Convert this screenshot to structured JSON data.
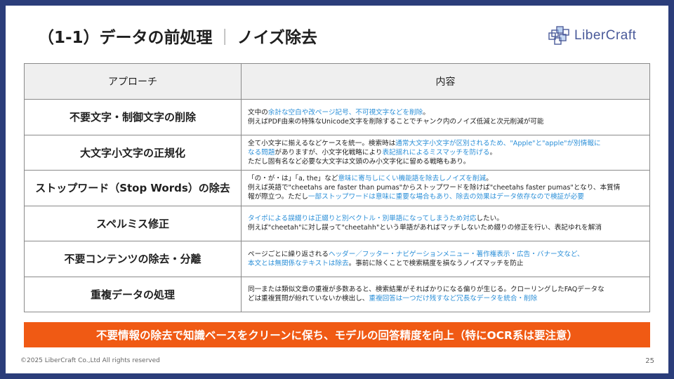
{
  "title": {
    "text": "（1-1）データの前処理",
    "separator": "｜",
    "subtitle": "ノイズ除去"
  },
  "logo": {
    "text": "LiberCraft",
    "icon": "cube-cluster-icon",
    "color": "#4a5a9a"
  },
  "table": {
    "headers": [
      "アプローチ",
      "内容"
    ],
    "rows": [
      {
        "approach": "不要文字・制御文字の削除",
        "lines": [
          [
            {
              "t": "文中の"
            },
            {
              "t": "余計な空白や改ページ記号、不可視文字などを削除",
              "h": true
            },
            {
              "t": "。"
            }
          ],
          [
            {
              "t": "例えばPDF由来の特殊なUnicode文字を削除することでチャンク内のノイズ低減と次元削減が可能"
            }
          ]
        ]
      },
      {
        "approach": "大文字小文字の正規化",
        "lines": [
          [
            {
              "t": "全て小文字に揃えるなどケースを統一。検索時は"
            },
            {
              "t": "通常大文字小文字が区別されるため、\"Apple\"と\"apple\"が別情報に",
              "h": true
            }
          ],
          [
            {
              "t": "なる問題",
              "h": true
            },
            {
              "t": "がありますが、小文字化戦略により"
            },
            {
              "t": "表記揺れによるミスマッチを防げる",
              "h": true
            },
            {
              "t": "。"
            }
          ],
          [
            {
              "t": "ただし固有名など必要な大文字は文頭のみ小文字化に留める戦略もあり。"
            }
          ]
        ]
      },
      {
        "approach": "ストップワード（Stop Words）の除去",
        "lines": [
          [
            {
              "t": "「の・が・は」「a, the」など"
            },
            {
              "t": "意味に寄与しにくい機能語を除去しノイズを削減",
              "h": true
            },
            {
              "t": "。"
            }
          ],
          [
            {
              "t": "例えば英語で\"cheetahs are faster than pumas\"からストップワードを除けば\"cheetahs faster pumas\"となり、本質情"
            }
          ],
          [
            {
              "t": "報が際立つ。ただし"
            },
            {
              "t": "一部ストップワードは意味に重要な場合もあり、除去の効果はデータ依存なので検証が必要",
              "h": true
            }
          ]
        ]
      },
      {
        "approach": "スペルミス修正",
        "lines": [
          [
            {
              "t": "タイポによる誤綴りは正綴りと別ベクトル・別単語になってしまうため対応",
              "h": true
            },
            {
              "t": "したい。"
            }
          ],
          [
            {
              "t": "例えば\"cheetah\"に対し誤って\"cheetahh\"という単語があればマッチしないため綴りの修正を行い、表記ゆれを解消"
            }
          ]
        ]
      },
      {
        "approach": "不要コンテンツの除去・分離",
        "lines": [
          [
            {
              "t": "ページごとに繰り返される"
            },
            {
              "t": "ヘッダー／フッター・ナビゲーションメニュー・著作権表示・広告・バナー文など、",
              "h": true
            }
          ],
          [
            {
              "t": "本文とは無関係なテキストは除去",
              "h": true
            },
            {
              "t": "。事前に除くことで検索精度を損なうノイズマッチを防止"
            }
          ]
        ]
      },
      {
        "approach": "重複データの処理",
        "lines": [
          [
            {
              "t": "同一または類似文章の重複が多数あると、検索結果がそればかりになる偏りが生じる。クローリングしたFAQデータな"
            }
          ],
          [
            {
              "t": "どは重複質問が紛れていないか検出し、"
            },
            {
              "t": "重複回答は一つだけ残すなど冗長なデータを統合・削除",
              "h": true
            }
          ]
        ]
      }
    ]
  },
  "banner": {
    "text": "不要情報の除去で知識ベースをクリーンに保ち、モデルの回答精度を向上（特にOCR系は要注意）",
    "color": "#f05a14"
  },
  "footer": {
    "copyright": "©2025 LiberCraft Co.,Ltd All rights reserved",
    "page_number": "25"
  },
  "colors": {
    "frame": "#2b3d7a",
    "highlight": "#2b8fd8",
    "header_bg": "#efefef"
  }
}
